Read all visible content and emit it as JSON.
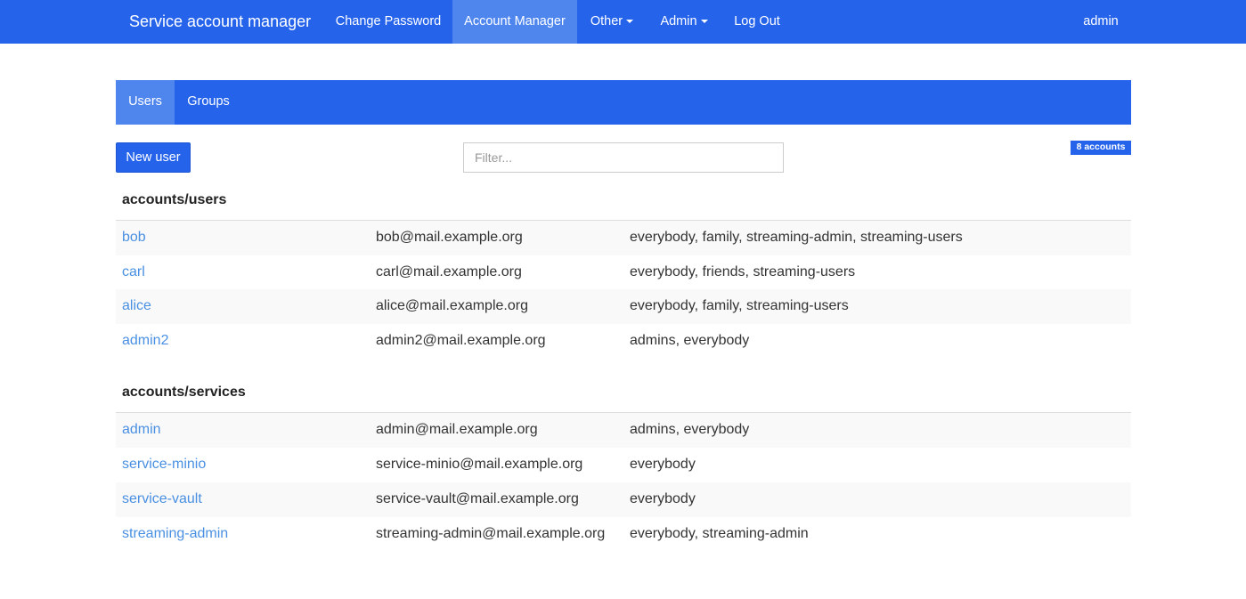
{
  "navbar": {
    "brand": "Service account manager",
    "items": [
      {
        "label": "Change Password"
      },
      {
        "label": "Account Manager"
      },
      {
        "label": "Other"
      },
      {
        "label": "Admin"
      },
      {
        "label": "Log Out"
      }
    ],
    "user": "admin"
  },
  "tabs": [
    {
      "label": "Users"
    },
    {
      "label": "Groups"
    }
  ],
  "toolbar": {
    "new_user_label": "New user",
    "filter_placeholder": "Filter...",
    "count_badge": "8 accounts"
  },
  "sections": [
    {
      "heading": "accounts/users",
      "rows": [
        {
          "name": "bob",
          "email": "bob@mail.example.org",
          "groups": "everybody, family, streaming-admin, streaming-users"
        },
        {
          "name": "carl",
          "email": "carl@mail.example.org",
          "groups": "everybody, friends, streaming-users"
        },
        {
          "name": "alice",
          "email": "alice@mail.example.org",
          "groups": "everybody, family, streaming-users"
        },
        {
          "name": "admin2",
          "email": "admin2@mail.example.org",
          "groups": "admins, everybody"
        }
      ]
    },
    {
      "heading": "accounts/services",
      "rows": [
        {
          "name": "admin",
          "email": "admin@mail.example.org",
          "groups": "admins, everybody"
        },
        {
          "name": "service-minio",
          "email": "service-minio@mail.example.org",
          "groups": "everybody"
        },
        {
          "name": "service-vault",
          "email": "service-vault@mail.example.org",
          "groups": "everybody"
        },
        {
          "name": "streaming-admin",
          "email": "streaming-admin@mail.example.org",
          "groups": "everybody, streaming-admin"
        }
      ]
    }
  ],
  "colors": {
    "primary": "#2563eb",
    "active": "#4f86ee",
    "link": "#4a90e2"
  }
}
